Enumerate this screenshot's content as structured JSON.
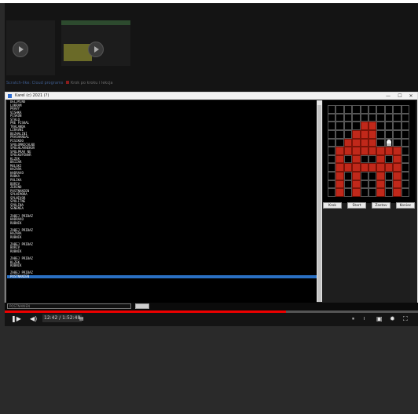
{
  "browser": {
    "thumb_title_left": "Scratch-like: Cloud programs",
    "thumb_title_right": "Krok po kroku i lekcja"
  },
  "window": {
    "title": "Karel  (c) 2021 (?)",
    "controls": [
      "—",
      "☐",
      "✕"
    ]
  },
  "program_lines": [
    "DELJMINO",
    "LUKRAM",
    "PRAVY",
    "VISHKA",
    "PISKON",
    "STALO",
    "PRE PISKAL",
    "TRALANDA",
    "LIRAVNI",
    "BEZHALINI",
    "PRASHANGAL",
    "PISIKOO",
    "SPOLOMNICALNO",
    "SPOLHLAVNEKUV",
    "SPOLPRAV NE",
    "SPOLKUPINAR",
    "KLZEK",
    "BRIZAR",
    "MULSKI",
    "HAZARA",
    "HADRAXO",
    "ROBKA",
    "POLIKA",
    "BORIV",
    "ZERINO",
    "POSTNANIEN",
    "SPLNIMORA",
    "SPLNIVOR",
    "SPOLITNE",
    "SPOLINA",
    "SENENSA",
    "",
    "ZABEJ PRIBAZ",
    "HADRAXO",
    "ROBNIK",
    "",
    "ZABEJ PRIBAZ",
    "HAZARA",
    "ROBNIK",
    "",
    "ZABEJ PRIBAZ",
    "BORIV",
    "ROBNIK",
    "",
    "ZABEJ PRIBAZ",
    "KLZEK",
    "ROBNIK",
    "",
    "ZABEJ PRIBAZ",
    "POSTNANIEN"
  ],
  "selected_line_index": 49,
  "buttons": {
    "krok": "Krok",
    "start": "Start",
    "zastav": "Zastav",
    "koniec": "Koniec"
  },
  "command_input": {
    "value": "POSTNANIEN"
  },
  "video": {
    "time_current": "12:42",
    "time_separator": " / ",
    "time_total": "1:52:48",
    "progress_fraction": 0.68,
    "icon_play": "play-icon",
    "icon_next": "next-icon",
    "icon_volume": "volume-icon",
    "icon_chapters": "chapters-icon",
    "icon_autoplay": "autoplay-icon",
    "icon_subtitles": "subtitles-icon",
    "icon_settings": "settings-icon",
    "icon_fullscreen": "fullscreen-icon"
  },
  "grid": {
    "cols": 10,
    "rows": 11,
    "red_cells": [
      [
        4,
        2
      ],
      [
        5,
        2
      ],
      [
        3,
        3
      ],
      [
        4,
        3
      ],
      [
        5,
        3
      ],
      [
        2,
        4
      ],
      [
        3,
        4
      ],
      [
        4,
        4
      ],
      [
        5,
        4
      ],
      [
        1,
        5
      ],
      [
        2,
        5
      ],
      [
        3,
        5
      ],
      [
        4,
        5
      ],
      [
        5,
        5
      ],
      [
        6,
        5
      ],
      [
        7,
        5
      ],
      [
        8,
        5
      ],
      [
        1,
        6
      ],
      [
        3,
        6
      ],
      [
        6,
        6
      ],
      [
        8,
        6
      ],
      [
        1,
        7
      ],
      [
        2,
        7
      ],
      [
        3,
        7
      ],
      [
        4,
        7
      ],
      [
        5,
        7
      ],
      [
        6,
        7
      ],
      [
        7,
        7
      ],
      [
        8,
        7
      ],
      [
        1,
        8
      ],
      [
        3,
        8
      ],
      [
        6,
        8
      ],
      [
        8,
        8
      ],
      [
        1,
        9
      ],
      [
        3,
        9
      ],
      [
        6,
        9
      ],
      [
        8,
        9
      ],
      [
        1,
        10
      ],
      [
        3,
        10
      ],
      [
        6,
        10
      ],
      [
        8,
        10
      ]
    ],
    "robot_cell": [
      7,
      4
    ],
    "red_color": "#c0281a"
  }
}
